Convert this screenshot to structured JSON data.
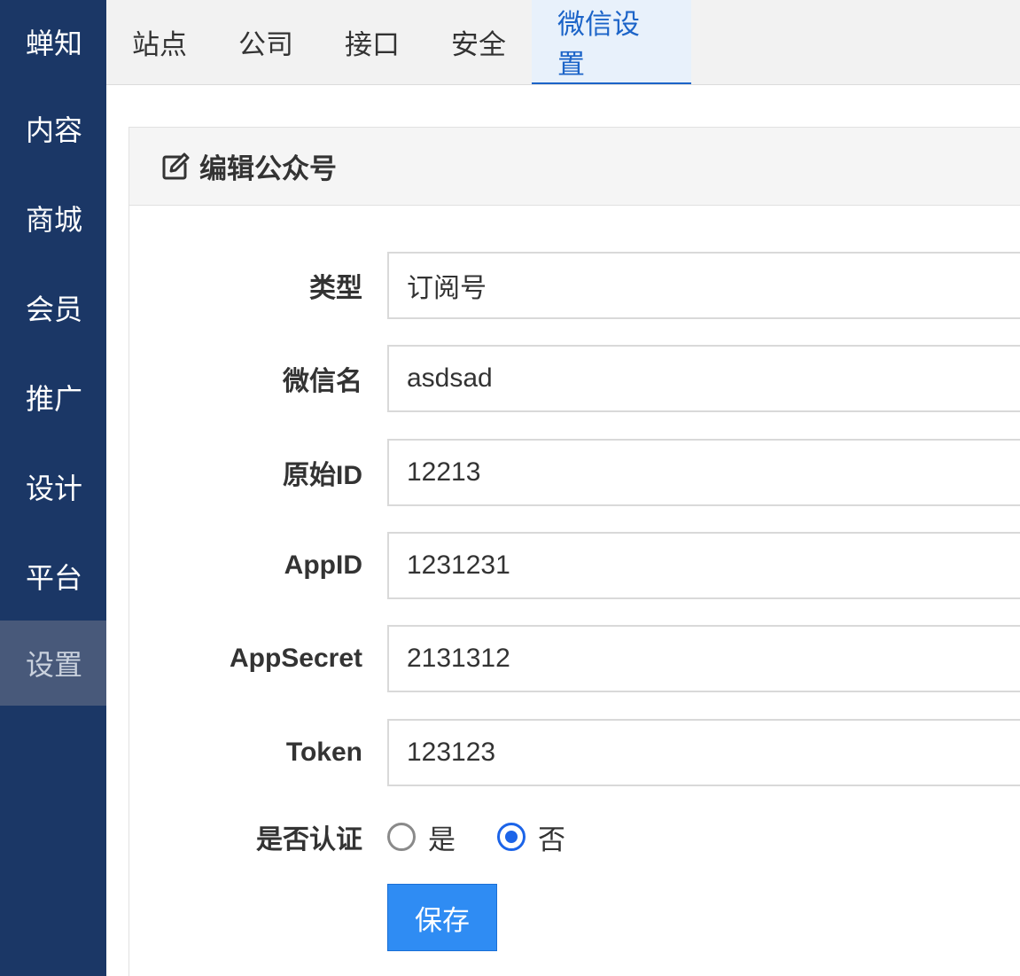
{
  "sidebar": {
    "brand": "蝉知",
    "items": [
      {
        "label": "内容"
      },
      {
        "label": "商城"
      },
      {
        "label": "会员"
      },
      {
        "label": "推广"
      },
      {
        "label": "设计"
      },
      {
        "label": "平台"
      },
      {
        "label": "设置",
        "active": true
      }
    ]
  },
  "tabs": [
    {
      "label": "站点"
    },
    {
      "label": "公司"
    },
    {
      "label": "接口"
    },
    {
      "label": "安全"
    },
    {
      "label": "微信设置",
      "active": true
    }
  ],
  "panel": {
    "title": "编辑公众号",
    "title_icon": "edit-icon"
  },
  "form": {
    "type": {
      "label": "类型",
      "value": "订阅号"
    },
    "wechat_name": {
      "label": "微信名",
      "value": "asdsad"
    },
    "original_id": {
      "label": "原始ID",
      "value": "12213"
    },
    "app_id": {
      "label": "AppID",
      "value": "1231231"
    },
    "app_secret": {
      "label": "AppSecret",
      "value": "2131312"
    },
    "token": {
      "label": "Token",
      "value": "123123"
    },
    "certified": {
      "label": "是否认证",
      "options": [
        {
          "label": "是",
          "checked": false
        },
        {
          "label": "否",
          "checked": true
        }
      ]
    },
    "save_label": "保存"
  },
  "colors": {
    "sidebar_bg": "#1b3766",
    "sidebar_active_bg": "#48597a",
    "accent": "#1c64c8",
    "button_bg": "#2f8cf3"
  }
}
